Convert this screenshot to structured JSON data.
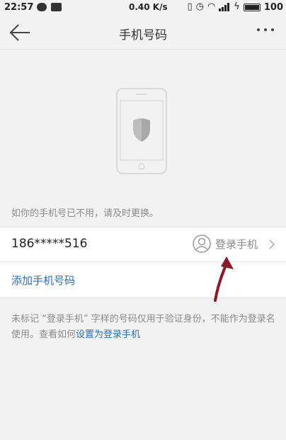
{
  "status_bar": {
    "time": "22:57",
    "speed": "0.40 K/s",
    "battery": "100"
  },
  "header": {
    "title": "手机号码"
  },
  "notice": "如你的手机号已不用，请及时更换。",
  "phone": {
    "number": "186*****516",
    "badge_label": "登录手机"
  },
  "add_phone_label": "添加手机号码",
  "footnote": {
    "text": "未标记 “登录手机” 字样的号码仅用于验证身份，不能作为登录名使用。查看如何",
    "link": "设置为登录手机"
  },
  "colors": {
    "background": "#f2f2f2",
    "card": "#ffffff",
    "link": "#2a6fb3",
    "muted_text": "#8a8a8a",
    "annotation_arrow": "#8a1a24"
  }
}
